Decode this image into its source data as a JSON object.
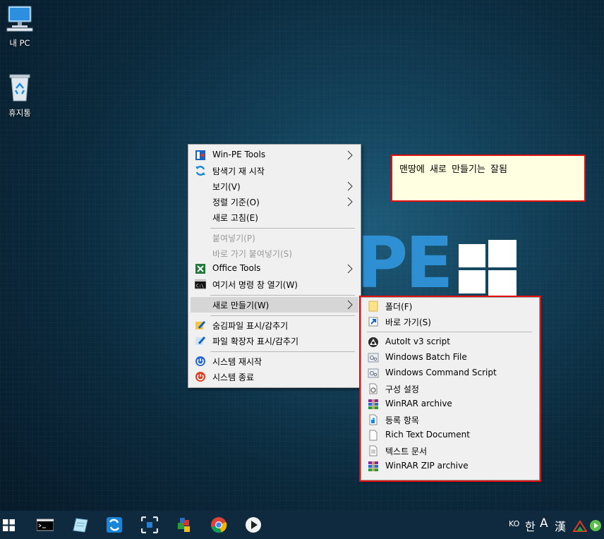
{
  "desktop": {
    "icons": [
      {
        "label": "내 PC",
        "icon": "computer-icon"
      },
      {
        "label": "휴지통",
        "icon": "recycle-bin-icon"
      }
    ],
    "wallpaper_text": "PE"
  },
  "note": {
    "text": "맨땅에  새로 만들기는  잘됨"
  },
  "context_menu": {
    "items": [
      {
        "label": "Win-PE Tools",
        "icon": "winpe-tools-icon",
        "submenu": true
      },
      {
        "label": "탐색기 재 시작",
        "icon": "refresh-explorer-icon"
      },
      {
        "label": "보기(V)",
        "submenu": true
      },
      {
        "label": "정렬 기준(O)",
        "submenu": true
      },
      {
        "label": "새로 고침(E)"
      },
      {
        "label": "붙여넣기(P)",
        "disabled": true
      },
      {
        "label": "바로 가기 붙여넣기(S)",
        "disabled": true
      },
      {
        "label": "Office Tools",
        "icon": "office-tools-icon",
        "submenu": true
      },
      {
        "label": "여기서 명령 창 열기(W)",
        "icon": "cmd-icon"
      },
      {
        "label": "새로 만들기(W)",
        "submenu": true,
        "highlighted": true
      },
      {
        "label": "숨김파일 표시/감추기",
        "icon": "hidden-files-icon"
      },
      {
        "label": "파일 확장자 표시/감추기",
        "icon": "file-extension-icon"
      },
      {
        "label": "시스템 재시작",
        "icon": "restart-icon"
      },
      {
        "label": "시스템 종료",
        "icon": "shutdown-icon"
      }
    ]
  },
  "new_submenu": {
    "items": [
      {
        "label": "폴더(F)",
        "icon": "folder-icon"
      },
      {
        "label": "바로 가기(S)",
        "icon": "shortcut-icon"
      },
      {
        "label": "AutoIt v3 script",
        "icon": "autoit-icon"
      },
      {
        "label": "Windows Batch File",
        "icon": "batch-file-icon"
      },
      {
        "label": "Windows Command Script",
        "icon": "command-script-icon"
      },
      {
        "label": "구성 설정",
        "icon": "config-settings-icon"
      },
      {
        "label": "WinRAR archive",
        "icon": "winrar-icon"
      },
      {
        "label": "등록 항목",
        "icon": "registry-entry-icon"
      },
      {
        "label": "Rich Text Document",
        "icon": "rich-text-icon"
      },
      {
        "label": "텍스트 문서",
        "icon": "text-document-icon"
      },
      {
        "label": "WinRAR ZIP archive",
        "icon": "winrar-zip-icon"
      }
    ]
  },
  "taskbar": {
    "apps": [
      "start-icon",
      "command-prompt-icon",
      "notepad-icon",
      "explorer-refresh-icon",
      "capture-tool-icon",
      "registry-tool-icon",
      "chrome-icon",
      "media-player-icon"
    ],
    "tray": {
      "lang": "KO",
      "ime_hangul": "한",
      "ime_alpha": "A",
      "ime_hanja": "漢"
    }
  },
  "colors": {
    "accent_red": "#e01010",
    "note_bg": "#ffffe1",
    "taskbar": "#0f2a3e",
    "menu_bg": "#f0f0f0"
  }
}
